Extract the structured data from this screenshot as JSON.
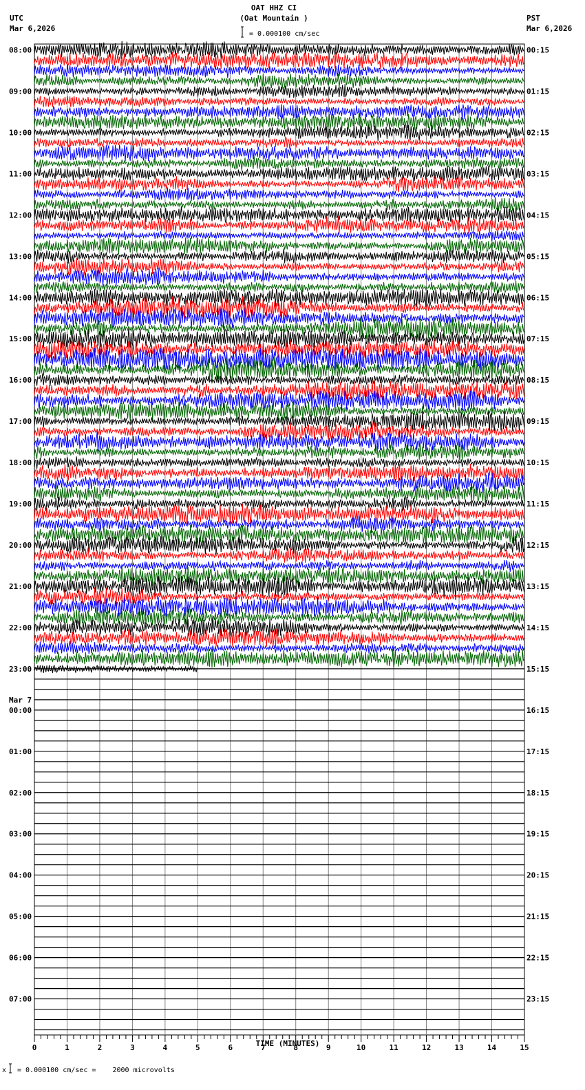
{
  "header": {
    "station": "OAT HHZ CI",
    "location": "(Oat Mountain )",
    "left_tz": "UTC",
    "left_date": "Mar 6,2026",
    "right_tz": "PST",
    "right_date": "Mar 6,2026",
    "scale": "= 0.000100 cm/sec"
  },
  "footer": {
    "scale": "= 0.000100 cm/sec =    2000 microvolts",
    "marker": "x"
  },
  "chart_data": {
    "type": "line",
    "subtype": "helicorder",
    "xlabel": "TIME (MINUTES)",
    "xlim": [
      0,
      15
    ],
    "x_ticks": [
      "0",
      "1",
      "2",
      "3",
      "4",
      "5",
      "6",
      "7",
      "8",
      "9",
      "10",
      "11",
      "12",
      "13",
      "14",
      "15"
    ],
    "minutes_per_line": 15,
    "lines_per_hour": 4,
    "trace_colors": [
      "#000000",
      "#ff0000",
      "#0000ff",
      "#006400"
    ],
    "grid": true,
    "left_labels": [
      "08:00",
      "09:00",
      "10:00",
      "11:00",
      "12:00",
      "13:00",
      "14:00",
      "15:00",
      "16:00",
      "17:00",
      "18:00",
      "19:00",
      "20:00",
      "21:00",
      "22:00",
      "23:00",
      "00:00",
      "01:00",
      "02:00",
      "03:00",
      "04:00",
      "05:00",
      "06:00",
      "07:00"
    ],
    "date_change_label": "Mar 7",
    "right_labels": [
      "00:15",
      "01:15",
      "02:15",
      "03:15",
      "04:15",
      "05:15",
      "06:15",
      "07:15",
      "08:15",
      "09:15",
      "10:15",
      "11:15",
      "12:15",
      "13:15",
      "14:15",
      "15:15",
      "16:15",
      "17:15",
      "18:15",
      "19:15",
      "20:15",
      "21:15",
      "22:15",
      "23:15"
    ],
    "data_end": {
      "hour_label": "23:00",
      "minutes": 5
    },
    "relative_amplitude_by_hour": [
      1.0,
      1.0,
      1.0,
      1.0,
      1.0,
      1.1,
      1.3,
      1.5,
      1.2,
      1.2,
      1.2,
      1.2,
      1.1,
      1.2,
      1.2,
      0.8
    ]
  }
}
